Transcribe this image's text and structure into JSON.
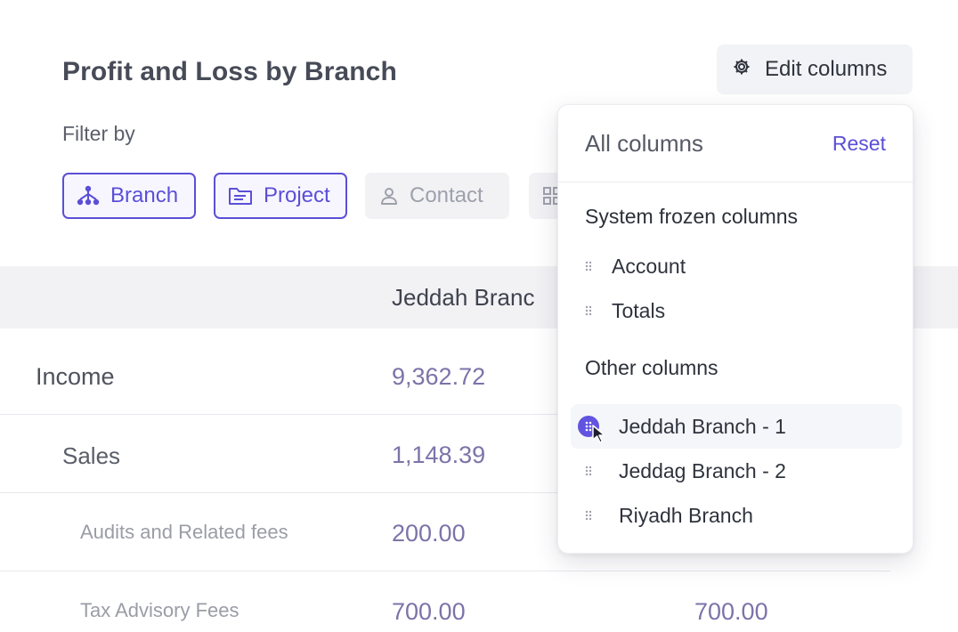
{
  "report": {
    "title": "Profit and Loss by Branch",
    "filter_label": "Filter by",
    "filters": [
      {
        "label": "Branch",
        "icon": "branch-icon",
        "active": true
      },
      {
        "label": "Project",
        "icon": "folder-icon",
        "active": true
      },
      {
        "label": "Contact",
        "icon": "person-icon",
        "active": false
      },
      {
        "label": "",
        "icon": "grid-icon",
        "active": false
      }
    ],
    "edit_columns_label": "Edit columns",
    "column_header": "Jeddah Branc",
    "rows": [
      {
        "account": "Income",
        "value": "9,362.72",
        "value2": ""
      },
      {
        "account": "Sales",
        "value": "1,148.39",
        "value2": ""
      },
      {
        "account": "Audits and Related fees",
        "value": "200.00",
        "value2": ""
      },
      {
        "account": "Tax Advisory Fees",
        "value": "700.00",
        "value2": "700.00"
      }
    ]
  },
  "columns_panel": {
    "title": "All columns",
    "reset_label": "Reset",
    "frozen_section_title": "System frozen columns",
    "frozen_columns": [
      "Account",
      "Totals"
    ],
    "other_section_title": "Other columns",
    "other_columns": [
      "Jeddah Branch - 1",
      "Jeddag Branch - 2",
      "Riyadh Branch"
    ]
  },
  "colors": {
    "accent": "#5b4fd6",
    "value_text": "#7d73a8",
    "header_bg": "#f2f2f5"
  }
}
